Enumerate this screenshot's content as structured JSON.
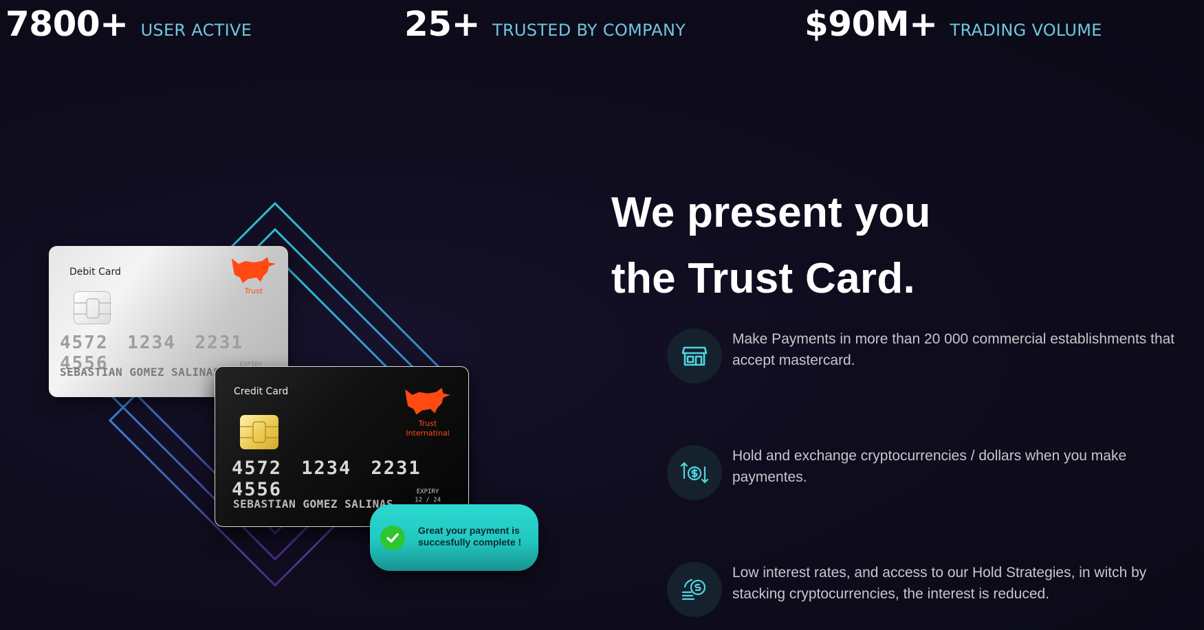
{
  "stats": [
    {
      "number": "7800+",
      "label": "USER ACTIVE"
    },
    {
      "number": "25+",
      "label": "TRUSTED BY COMPANY"
    },
    {
      "number": "$90M+",
      "label": "TRADING VOLUME"
    }
  ],
  "cards": {
    "debit": {
      "type": "Debit Card",
      "brand": "Trust",
      "number": "4572 1234 2231 4556",
      "holder": "SEBASTIAN GOMEZ SALINAS",
      "expiry_label": "EXPIRY"
    },
    "credit": {
      "type": "Credit Card",
      "brand_line1": "Trust",
      "brand_line2": "Internatinal",
      "number": "4572 1234 2231 4556",
      "holder": "SEBASTIAN GOMEZ SALINAS",
      "expiry_label": "EXPIRY",
      "expiry_value": "12 / 24"
    }
  },
  "toast": {
    "line1": "Great your payment is",
    "line2": "succesfully complete !"
  },
  "headline": {
    "line1": "We present you",
    "line2": "the Trust Card."
  },
  "features": [
    {
      "icon": "store-icon",
      "text": "Make Payments in more than 20 000 commercial establishments that accept mastercard."
    },
    {
      "icon": "dollar-exchange-icon",
      "text": "Hold and exchange cryptocurrencies / dollars when you make paymentes."
    },
    {
      "icon": "coins-stack-icon",
      "text": "Low interest rates, and access to our Hold Strategies, in witch by stacking cryptocurrencies, the interest is reduced."
    }
  ],
  "colors": {
    "accent_cyan": "#2bd9d0",
    "label_blue": "#6fc7de",
    "brand_orange": "#ff4a12",
    "background": "#0f0c1e"
  }
}
